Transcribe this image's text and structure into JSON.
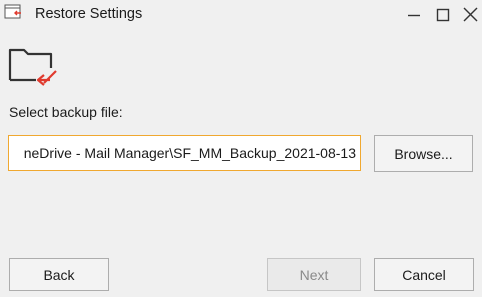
{
  "window": {
    "title": "Restore Settings"
  },
  "form": {
    "select_label": "Select backup file:",
    "path_value": "neDrive - Mail Manager\\SF_MM_Backup_2021-08-13"
  },
  "buttons": {
    "browse": "Browse...",
    "back": "Back",
    "next": "Next",
    "cancel": "Cancel"
  },
  "colors": {
    "input_focus_border": "#f0a830",
    "arrow_red": "#e03a2e"
  },
  "icons": {
    "app": "restore-app-icon",
    "folder": "folder-restore-icon",
    "minimize": "minimize-icon",
    "maximize": "maximize-icon",
    "close": "close-icon"
  }
}
